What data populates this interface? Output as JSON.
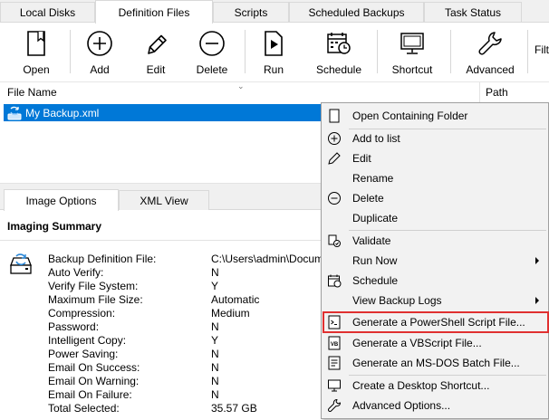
{
  "tabs": [
    "Local Disks",
    "Definition Files",
    "Scripts",
    "Scheduled Backups",
    "Task Status"
  ],
  "active_tab": "Definition Files",
  "toolbar": {
    "open": "Open",
    "add": "Add",
    "edit": "Edit",
    "delete": "Delete",
    "run": "Run",
    "schedule": "Schedule",
    "shortcut": "Shortcut",
    "advanced": "Advanced",
    "filter_partial": "Filt"
  },
  "list": {
    "col_file_name": "File Name",
    "col_path": "Path",
    "rows": [
      {
        "name": "My Backup.xml",
        "selected": true
      }
    ]
  },
  "subtabs": [
    "Image Options",
    "XML View"
  ],
  "summary": {
    "title": "Imaging Summary",
    "rows": [
      {
        "k": "Backup Definition File:",
        "v": "C:\\Users\\admin\\Docum"
      },
      {
        "k": "Auto Verify:",
        "v": "N"
      },
      {
        "k": "Verify File System:",
        "v": "Y"
      },
      {
        "k": "Maximum File Size:",
        "v": "Automatic"
      },
      {
        "k": "Compression:",
        "v": "Medium"
      },
      {
        "k": "Password:",
        "v": "N"
      },
      {
        "k": "Intelligent Copy:",
        "v": "Y"
      },
      {
        "k": "Power Saving:",
        "v": "N"
      },
      {
        "k": "Email On Success:",
        "v": "N"
      },
      {
        "k": "Email On Warning:",
        "v": "N"
      },
      {
        "k": "Email On Failure:",
        "v": "N"
      },
      {
        "k": "Total Selected:",
        "v": "35.57 GB"
      }
    ]
  },
  "context_menu": {
    "items": [
      {
        "label": "Open Containing Folder",
        "icon": "page-icon"
      },
      {
        "label": "Add to list",
        "icon": "plus-circle-icon"
      },
      {
        "label": "Edit",
        "icon": "pencil-icon"
      },
      {
        "label": "Rename",
        "icon": ""
      },
      {
        "label": "Delete",
        "icon": "minus-circle-icon"
      },
      {
        "label": "Duplicate",
        "icon": ""
      },
      {
        "label": "Validate",
        "icon": "validate-icon"
      },
      {
        "label": "Run Now",
        "icon": "",
        "submenu": true
      },
      {
        "label": "Schedule",
        "icon": "calendar-icon"
      },
      {
        "label": "View Backup Logs",
        "icon": "",
        "submenu": true
      },
      {
        "label": "Generate a PowerShell Script File...",
        "icon": "powershell-icon",
        "highlighted": true
      },
      {
        "label": "Generate a VBScript File...",
        "icon": "vbscript-icon"
      },
      {
        "label": "Generate an MS-DOS Batch File...",
        "icon": "batch-icon"
      },
      {
        "label": "Create a Desktop Shortcut...",
        "icon": "shortcut-icon"
      },
      {
        "label": "Advanced Options...",
        "icon": "wrench-icon"
      }
    ]
  },
  "colors": {
    "selection": "#0078d7",
    "highlight_outline": "#e03030",
    "menu_bg": "#f2f2f2"
  }
}
